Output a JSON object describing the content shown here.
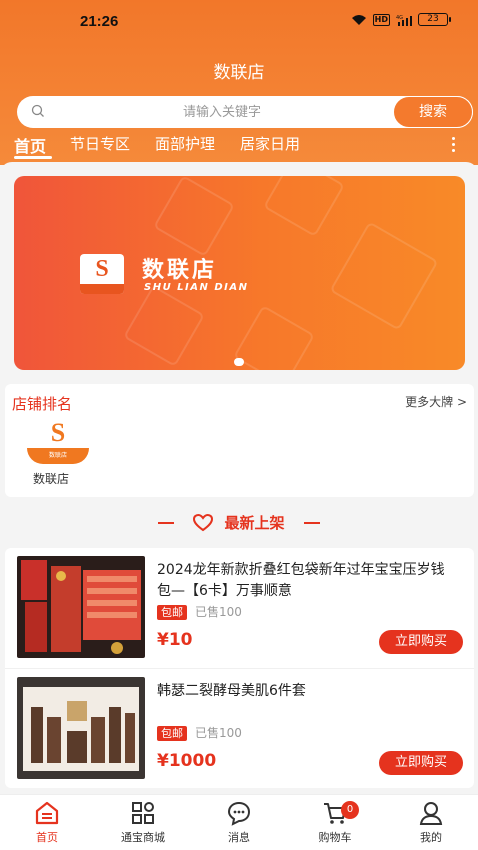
{
  "status_bar": {
    "time": "21:26",
    "hd": "HD",
    "network": "4G",
    "battery": "23"
  },
  "app_title": "数联店",
  "search": {
    "placeholder": "请输入关键字",
    "button_label": "搜索"
  },
  "tabs": [
    {
      "label": "首页",
      "active": true
    },
    {
      "label": "节日专区",
      "active": false
    },
    {
      "label": "面部护理",
      "active": false
    },
    {
      "label": "居家日用",
      "active": false
    }
  ],
  "banner": {
    "name": "数联店",
    "subtitle": "SHU LIAN DIAN",
    "logo_text": "数联店"
  },
  "store_ranking": {
    "title": "店铺排名",
    "more_label": "更多大牌 >",
    "stores": [
      {
        "name": "数联店",
        "logo_text": "数联店"
      }
    ]
  },
  "section": {
    "title": "最新上架"
  },
  "products": [
    {
      "title": "2024龙年新款折叠红包袋新年过年宝宝压岁钱包—【6卡】万事顺意",
      "free_shipping": "包邮",
      "sold": "已售100",
      "price": "¥10",
      "buy_label": "立即购买"
    },
    {
      "title": "韩瑟二裂酵母美肌6件套",
      "free_shipping": "包邮",
      "sold": "已售100",
      "price": "¥1000",
      "buy_label": "立即购买"
    }
  ],
  "bottom_nav": [
    {
      "label": "首页",
      "icon": "home-icon",
      "active": true
    },
    {
      "label": "通宝商城",
      "icon": "grid-icon",
      "active": false
    },
    {
      "label": "消息",
      "icon": "message-icon",
      "active": false
    },
    {
      "label": "购物车",
      "icon": "cart-icon",
      "active": false,
      "badge": "0"
    },
    {
      "label": "我的",
      "icon": "profile-icon",
      "active": false
    }
  ],
  "colors": {
    "header_orange": "#f2772a",
    "accent_red": "#e5331e"
  }
}
